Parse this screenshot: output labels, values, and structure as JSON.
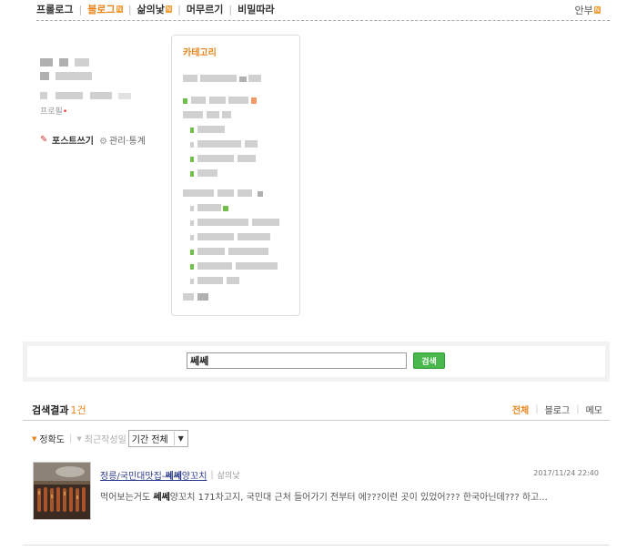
{
  "topnav": {
    "items": [
      {
        "label": "프롤로그",
        "badge": ""
      },
      {
        "label": "블로그",
        "badge": "N"
      },
      {
        "label": "삶의낯",
        "badge": "N"
      },
      {
        "label": "머무르기",
        "badge": ""
      },
      {
        "label": "비밀따라",
        "badge": ""
      }
    ],
    "active_index": 1,
    "right_link": "안부",
    "right_badge": "N"
  },
  "sidebar": {
    "profile_link": "프로필",
    "write_post": "포스트쓰기",
    "manage": "관리·통계"
  },
  "category": {
    "title": "카테고리"
  },
  "search": {
    "query": "쎄쎄",
    "button": "검색"
  },
  "results": {
    "label": "검색결과",
    "count": "1건",
    "tabs": [
      "전체",
      "블로그",
      "메모"
    ],
    "active_tab": 0
  },
  "sort": {
    "accuracy": "정확도",
    "recent": "최근작성일",
    "period": "기간 전체"
  },
  "result_item": {
    "title_prefix": "정릉/국민대맛집-",
    "title_highlight": "쎄쎄",
    "title_suffix": "양꼬치",
    "category": "삶의낯",
    "date": "2017/11/24 22:40",
    "snippet_prefix": "먹어보는거도 ",
    "snippet_highlight": "쎄쎄",
    "snippet_suffix": "양꼬치 171차고지, 국민대 근처 들어가기 전부터 에???이런 곳이 있었어??? 한국아닌데??? 하고..."
  },
  "colors": {
    "accent": "#e8841a",
    "search_button": "#48b84c",
    "link": "#2d3c8c"
  }
}
